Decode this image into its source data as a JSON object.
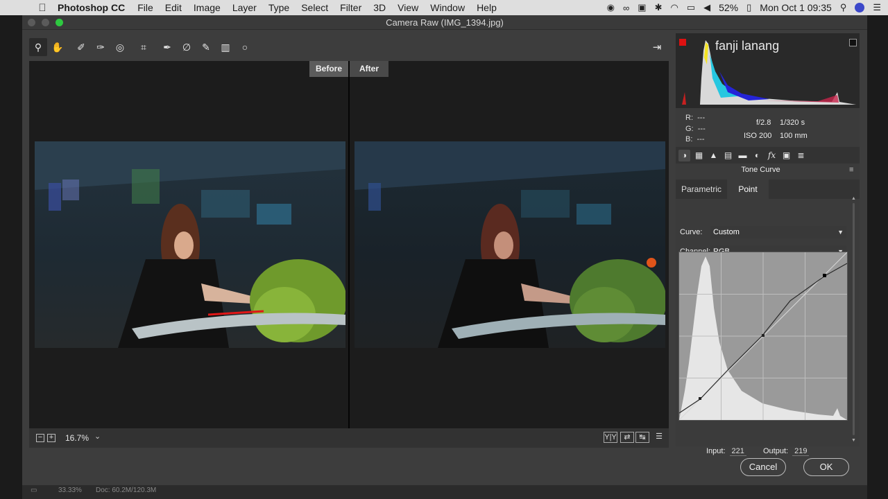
{
  "menubar": {
    "app_name": "Photoshop CC",
    "menus": [
      "File",
      "Edit",
      "Image",
      "Layer",
      "Type",
      "Select",
      "Filter",
      "3D",
      "View",
      "Window",
      "Help"
    ],
    "battery": "52%",
    "clock": "Mon Oct 1  09:35"
  },
  "window": {
    "title": "Camera Raw (IMG_1394.jpg)"
  },
  "tools": [
    {
      "name": "zoom-tool",
      "icon": "magnifier-icon",
      "glyph": "⚲"
    },
    {
      "name": "hand-tool",
      "icon": "hand-icon",
      "glyph": "✋"
    },
    {
      "name": "white-balance-tool",
      "icon": "eyedropper-icon",
      "glyph": "✐"
    },
    {
      "name": "color-sampler-tool",
      "icon": "color-sampler-icon",
      "glyph": "✑"
    },
    {
      "name": "targeted-adjustment-tool",
      "icon": "target-adjust-icon",
      "glyph": "◎"
    },
    {
      "name": "crop-tool",
      "icon": "crop-icon",
      "glyph": "⌗"
    },
    {
      "name": "spot-removal-tool",
      "icon": "spot-removal-icon",
      "glyph": "✒"
    },
    {
      "name": "red-eye-tool",
      "icon": "red-eye-icon",
      "glyph": "∅"
    },
    {
      "name": "adjustment-brush-tool",
      "icon": "brush-icon",
      "glyph": "✎"
    },
    {
      "name": "graduated-filter-tool",
      "icon": "graduated-filter-icon",
      "glyph": "▥"
    },
    {
      "name": "radial-filter-tool",
      "icon": "radial-filter-icon",
      "glyph": "○"
    }
  ],
  "preview": {
    "before_label": "Before",
    "after_label": "After",
    "zoom": "16.7%"
  },
  "histogram": {
    "watermark": "fanji lanang",
    "r_label": "R:",
    "r_value": "---",
    "g_label": "G:",
    "g_value": "---",
    "b_label": "B:",
    "b_value": "---",
    "aperture": "f/2.8",
    "shutter": "1/320 s",
    "iso": "ISO 200",
    "focal": "100 mm"
  },
  "panel": {
    "title": "Tone Curve",
    "tabs": [
      "Parametric",
      "Point"
    ],
    "active_tab": "Point",
    "curve_label": "Curve:",
    "curve_value": "Custom",
    "channel_label": "Channel:",
    "channel_value": "RGB",
    "input_label": "Input:",
    "input_value": "221",
    "output_label": "Output:",
    "output_value": "219"
  },
  "dialog": {
    "cancel": "Cancel",
    "ok": "OK"
  },
  "status": {
    "zoom": "33.33%",
    "doc": "Doc: 60.2M/120.3M"
  },
  "colors": {
    "accent_red": "#dd1111",
    "panel_bg": "#3b3b3b",
    "canvas_bg": "#1c1c1c"
  }
}
